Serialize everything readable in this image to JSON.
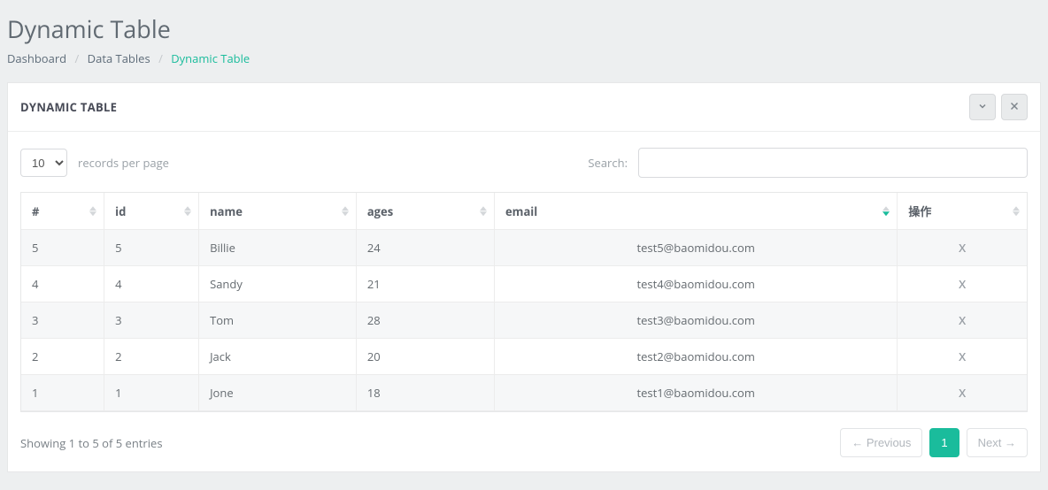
{
  "page_title": "Dynamic Table",
  "breadcrumb": {
    "items": [
      "Dashboard",
      "Data Tables",
      "Dynamic Table"
    ]
  },
  "panel": {
    "title": "DYNAMIC TABLE"
  },
  "length": {
    "value": "10",
    "label": "records per page"
  },
  "search": {
    "label": "Search:",
    "value": ""
  },
  "columns": [
    "#",
    "id",
    "name",
    "ages",
    "email",
    "操作"
  ],
  "sorted_column_index": 4,
  "rows": [
    {
      "num": "5",
      "id": "5",
      "name": "Billie",
      "ages": "24",
      "email": "test5@baomidou.com",
      "action": "X"
    },
    {
      "num": "4",
      "id": "4",
      "name": "Sandy",
      "ages": "21",
      "email": "test4@baomidou.com",
      "action": "X"
    },
    {
      "num": "3",
      "id": "3",
      "name": "Tom",
      "ages": "28",
      "email": "test3@baomidou.com",
      "action": "X"
    },
    {
      "num": "2",
      "id": "2",
      "name": "Jack",
      "ages": "20",
      "email": "test2@baomidou.com",
      "action": "X"
    },
    {
      "num": "1",
      "id": "1",
      "name": "Jone",
      "ages": "18",
      "email": "test1@baomidou.com",
      "action": "X"
    }
  ],
  "info": "Showing 1 to 5 of 5 entries",
  "pager": {
    "prev": "← Previous",
    "next": "Next →",
    "pages": [
      "1"
    ],
    "active": "1"
  }
}
